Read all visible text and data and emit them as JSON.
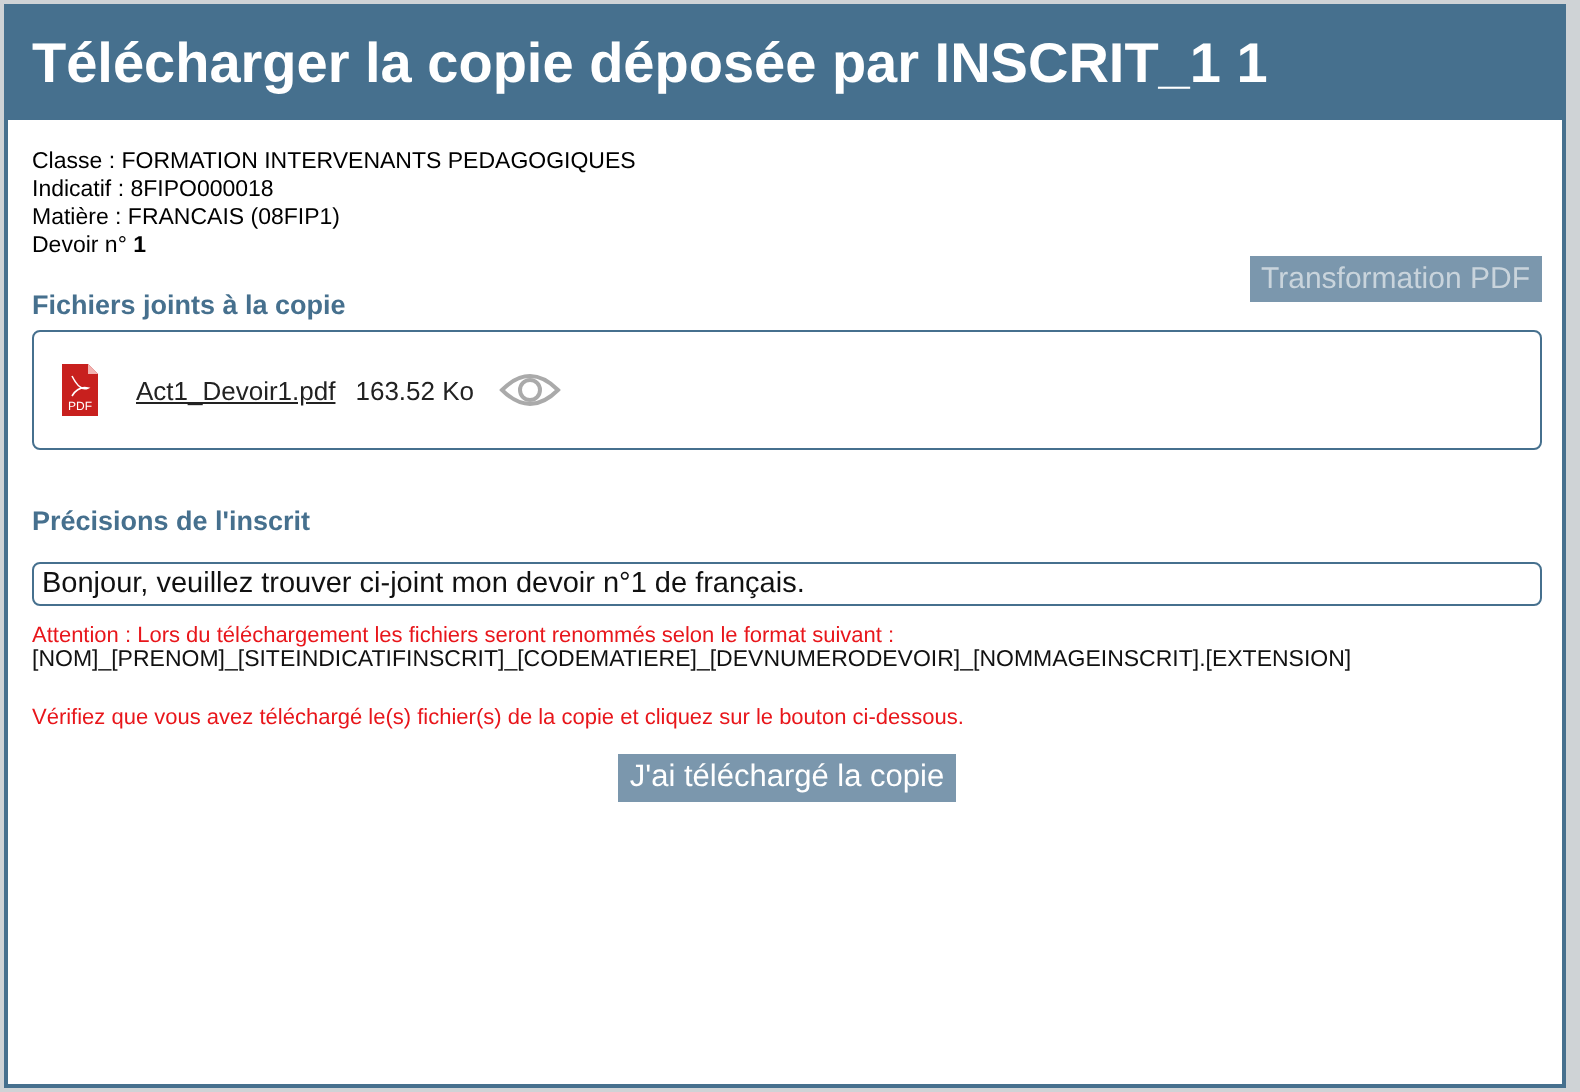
{
  "dialog": {
    "title": "Télécharger la copie déposée par INSCRIT_1 1"
  },
  "info": [
    "Classe :  FORMATION INTERVENANTS PEDAGOGIQUES",
    "Indicatif :  8FIPO000018",
    "Matière :  FRANCAIS (08FIP1)",
    "Devoir n° **1**"
  ],
  "transform_button": {
    "label": "Transformation PDF",
    "disabled": true
  },
  "files_section": {
    "heading": "Fichiers joints à la copie",
    "files": [
      {
        "name": "Act1_Devoir1.pdf",
        "size": "163.52 Ko",
        "icon_label": "PDF"
      }
    ]
  },
  "notes_section": {
    "heading": "Précisions de l'inscrit",
    "value": "Bonjour, veuillez trouver ci-joint mon devoir n°1 de français."
  },
  "warning": "Attention : Lors du téléchargement les fichiers seront renommés selon le format suivant :",
  "format": "[NOM]_[PRENOM]_[SITEINDICATIFINSCRIT]_[CODEMATIERE]_[DEVNUMERODEVOIR]_[NOMMAGEINSCRIT].[EXTENSION]",
  "check_notice": "Vérifiez que vous avez téléchargé le(s) fichier(s) de la copie et cliquez sur le bouton ci-dessous.",
  "confirm_button": {
    "label": "J'ai téléchargé la copie"
  }
}
